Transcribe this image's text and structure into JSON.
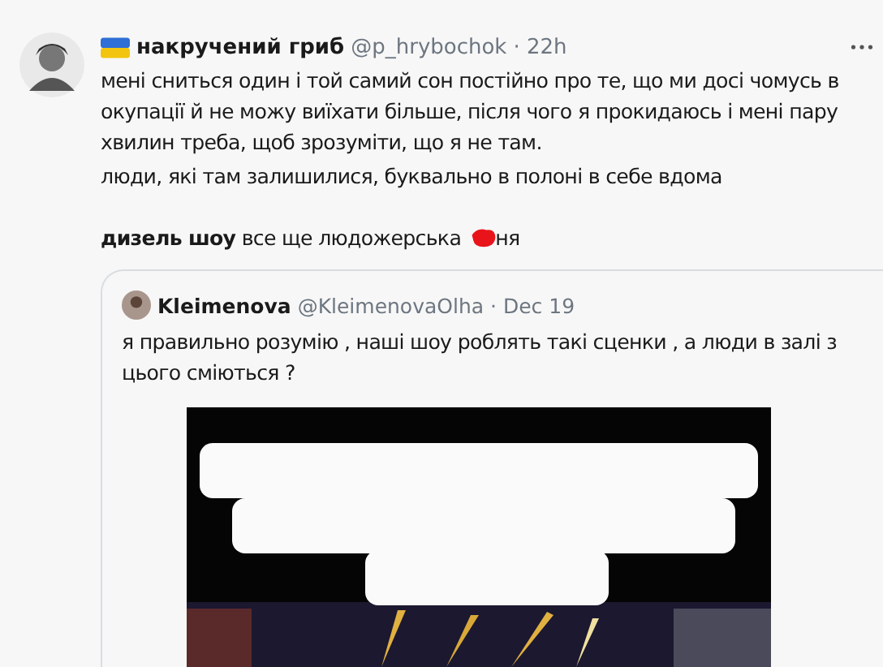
{
  "tweet": {
    "author": "накручений гриб",
    "handle": "@p_hrybochok",
    "time": "· 22h",
    "paragraphs": [
      "мені сниться один і той самий сон постійно про те, що ми досі чомусь в окупації й не можу виїхати більше, після чого я прокидаюсь і мені пару хвилин треба, щоб зрозуміти, що я не там.",
      "люди, які там залишилися, буквально  в полоні в себе вдома"
    ],
    "last_line": {
      "before": "**дизель шоу** все ще людожерська",
      "after": "ня"
    },
    "quote": {
      "author": "Kleimenova",
      "handle": "@KleimenovaOlha",
      "time": "· Dec 19",
      "text": "я правильно розумію , наші шоу роблять такі сценки , а люди в залі з цього сміються ?"
    }
  }
}
